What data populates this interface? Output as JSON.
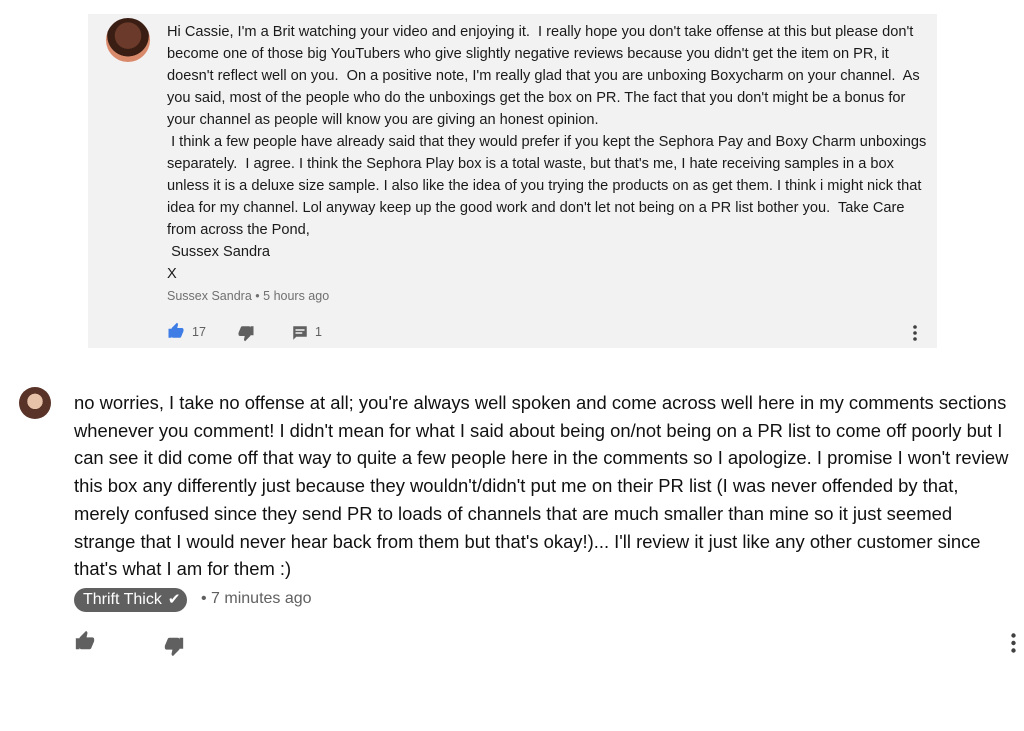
{
  "original_comment": {
    "text": "Hi Cassie, I'm a Brit watching your video and enjoying it.  I really hope you don't take offense at this but please don't become one of those big YouTubers who give slightly negative reviews because you didn't get the item on PR, it doesn't reflect well on you.  On a positive note, I'm really glad that you are unboxing Boxycharm on your channel.  As you said, most of the people who do the unboxings get the box on PR. The fact that you don't might be a bonus for your channel as people will know you are giving an honest opinion.\n I think a few people have already said that they would prefer if you kept the Sephora Pay and Boxy Charm unboxings separately.  I agree. I think the Sephora Play box is a total waste, but that's me, I hate receiving samples in a box unless it is a deluxe size sample. I also like the idea of you trying the products on as get them. I think i might nick that idea for my channel. Lol anyway keep up the good work and don't let not being on a PR list bother you.  Take Care from across the Pond,\n Sussex Sandra\nX",
    "author": "Sussex Sandra",
    "separator": "•",
    "time": "5 hours ago",
    "like_count": "17",
    "reply_count": "1"
  },
  "reply": {
    "text": "no worries, I take no offense at all; you're always well spoken and come across well here in my comments sections whenever you comment! I didn't mean for what I said about being on/not being on a PR list to come off poorly but I can see it did come off that way to quite a few people here in the comments so I apologize. I promise I won't review this box any differently just because they wouldn't/didn't put me on their PR list (I was never offended by that, merely confused since they send PR to loads of channels that are much smaller than mine so it just seemed strange that I would never hear back from them but that's okay!)... I'll review it just like any other customer since that's what I am for them :)",
    "author": "Thrift Thick",
    "verified_icon": "check-icon",
    "time": "• 7 minutes ago"
  },
  "icons": {
    "like": "thumbs-up-icon",
    "dislike": "thumbs-down-icon",
    "reply": "comment-icon",
    "menu": "more-vertical-icon"
  },
  "colors": {
    "like_active": "#3e7ce6",
    "icon_gray": "#606060",
    "card_bg": "#f2f2f2",
    "badge_bg": "#606060"
  }
}
